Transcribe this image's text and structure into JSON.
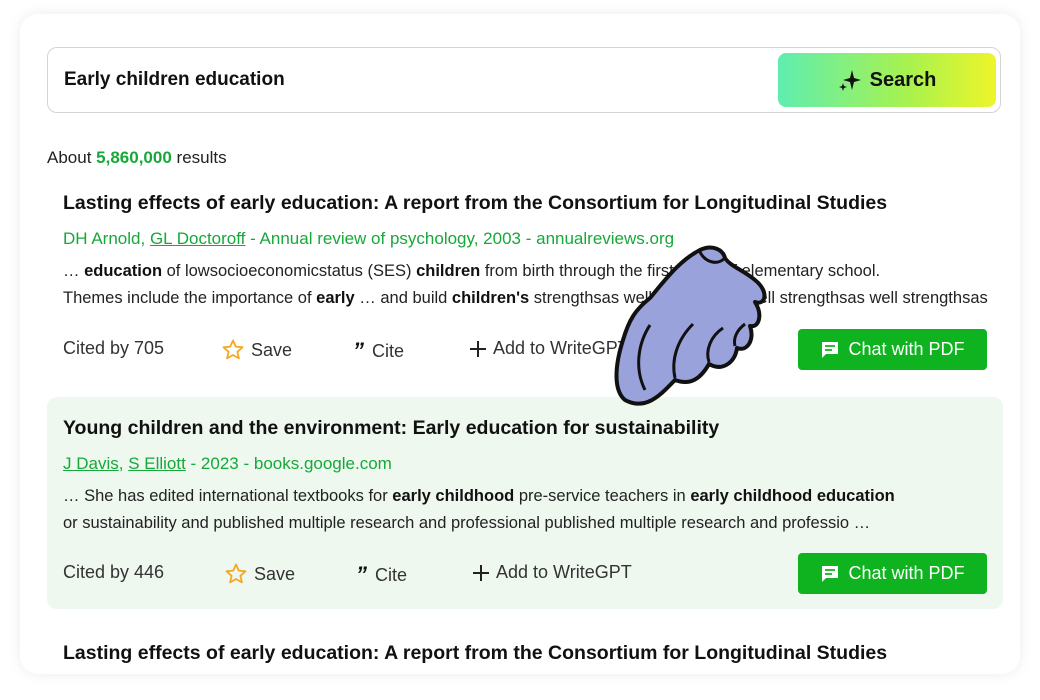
{
  "search": {
    "query": "Early children education",
    "button_label": "Search"
  },
  "summary": {
    "prefix": "About",
    "count": "5,860,000",
    "suffix": "results"
  },
  "results": [
    {
      "title": "Lasting effects of early education: A report from the Consortium for Longitudinal Studies",
      "author1": "DH Arnold",
      "sep": ", ",
      "author2": "GL Doctoroff",
      "source": " - Annual review of psychology, 2003 - annualreviews.org",
      "snippet1": [
        {
          "t": "… ",
          "b": false
        },
        {
          "t": "education",
          "b": true
        },
        {
          "t": " of lowsocioeconomicstatus (SES) ",
          "b": false
        },
        {
          "t": "children",
          "b": true
        },
        {
          "t": " from birth through the first years of elementary school.",
          "b": false
        }
      ],
      "snippet2": [
        {
          "t": "Themes include the importance of ",
          "b": false
        },
        {
          "t": "early",
          "b": true
        },
        {
          "t": " … and build ",
          "b": false
        },
        {
          "t": "children's",
          "b": true
        },
        {
          "t": " strengthsas well strengthsas well strengthsas well strengthsas …",
          "b": false
        }
      ],
      "cited": "Cited by 705",
      "save": "Save",
      "cite": "Cite",
      "add": "Add to WriteGPT",
      "chat": "Chat with PDF"
    },
    {
      "title": "Young children and the environment: Early education for sustainability",
      "author1": "J Davis",
      "sep": ", ",
      "author2": "S Elliott",
      "source": " - 2023 - books.google.com",
      "snippet1": [
        {
          "t": "… She has edited international textbooks for ",
          "b": false
        },
        {
          "t": "early childhood",
          "b": true
        },
        {
          "t": " pre-service teachers in ",
          "b": false
        },
        {
          "t": "early childhood education",
          "b": true
        }
      ],
      "snippet2": [
        {
          "t": "or sustainability and published multiple research and professional published multiple research and professio …",
          "b": false
        }
      ],
      "cited": "Cited by 446",
      "save": "Save",
      "cite": "Cite",
      "add": "Add to WriteGPT",
      "chat": "Chat with PDF"
    },
    {
      "title": "Lasting effects of early education: A report from the Consortium for Longitudinal Studies"
    }
  ],
  "colors": {
    "accent_green": "#16a83a",
    "chat_button": "#0fb320",
    "highlight_bg": "#eef8ef",
    "search_gradient": [
      "#5fedb0",
      "#eef52a"
    ]
  },
  "icons": [
    "sparkle-icon",
    "star-icon",
    "quote-icon",
    "plus-icon",
    "chat-icon",
    "pointing-hand-icon"
  ]
}
